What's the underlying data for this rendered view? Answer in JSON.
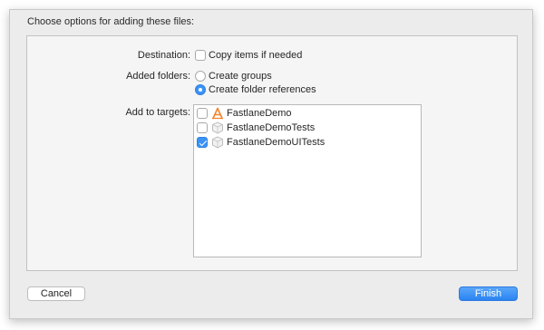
{
  "dialog": {
    "title": "Choose options for adding these files:"
  },
  "destination": {
    "label": "Destination:",
    "copy_items_label": "Copy items if needed",
    "copy_items_checked": false
  },
  "added_folders": {
    "label": "Added folders:",
    "options": [
      {
        "label": "Create groups",
        "selected": false
      },
      {
        "label": "Create folder references",
        "selected": true
      }
    ]
  },
  "targets": {
    "label": "Add to targets:",
    "items": [
      {
        "name": "FastlaneDemo",
        "icon": "app-target-icon",
        "checked": false
      },
      {
        "name": "FastlaneDemoTests",
        "icon": "test-bundle-icon",
        "checked": false
      },
      {
        "name": "FastlaneDemoUITests",
        "icon": "test-bundle-icon",
        "checked": true
      }
    ]
  },
  "buttons": {
    "cancel": "Cancel",
    "finish": "Finish"
  },
  "colors": {
    "accent": "#3b93f5",
    "sheet_background": "#ececec",
    "app_icon_orange": "#f0842c"
  }
}
